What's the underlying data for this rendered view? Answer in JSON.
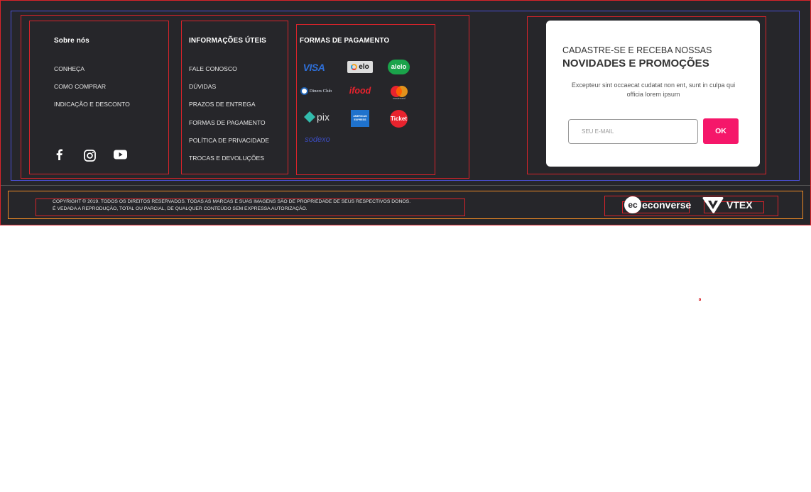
{
  "about": {
    "title": "Sobre nós",
    "links": [
      "CONHEÇA",
      "COMO COMPRAR",
      "INDICAÇÃO E DESCONTO"
    ]
  },
  "social": {
    "icons": [
      "facebook-icon",
      "instagram-icon",
      "youtube-icon"
    ]
  },
  "info": {
    "title": "INFORMAÇÕES ÚTEIS",
    "links": [
      "FALE CONOSCO",
      "DÚVIDAS",
      "PRAZOS DE ENTREGA",
      "FORMAS DE PAGAMENTO",
      "POLÍTICA DE PRIVACIDADE",
      "TROCAS E DEVOLUÇÕES"
    ]
  },
  "payment": {
    "title": "FORMAS DE PAGAMENTO",
    "methods": [
      "VISA",
      "elo",
      "alelo",
      "Diners Club",
      "ifood",
      "mastercard",
      "pix",
      "AMERICAN EXPRESS",
      "Ticket",
      "sodexo"
    ]
  },
  "newsletter": {
    "line1": "CADASTRE-SE E RECEBA NOSSAS",
    "line2": "NOVIDADES E PROMOÇÕES",
    "description": "Excepteur sint occaecat cudatat non ent, sunt in culpa qui officia lorem ipsum",
    "email_placeholder": "SEU E-MAIL",
    "submit_label": "OK"
  },
  "copyright": {
    "line1": "COPYRIGHT © 2019. TODOS OS DIREITOS RESERVADOS. TODAS AS MARCAS E SUAS IMAGENS SÃO DE PROPRIEDADE DE SEUS RESPECTIVOS DONOS.",
    "line2": "É VEDADA A REPRODUÇÃO, TOTAL OU PARCIAL, DE QUALQUER CONTEÚDO SEM EXPRESSA AUTORIZAÇÃO."
  },
  "partners": {
    "econverse": "econverse",
    "vtex": "VTEX"
  },
  "colors": {
    "footer_bg": "#26262a",
    "accent": "#f5176a",
    "debug_red": "#d8232a",
    "debug_blue": "#4a4fd6",
    "debug_orange": "#f08a24"
  }
}
